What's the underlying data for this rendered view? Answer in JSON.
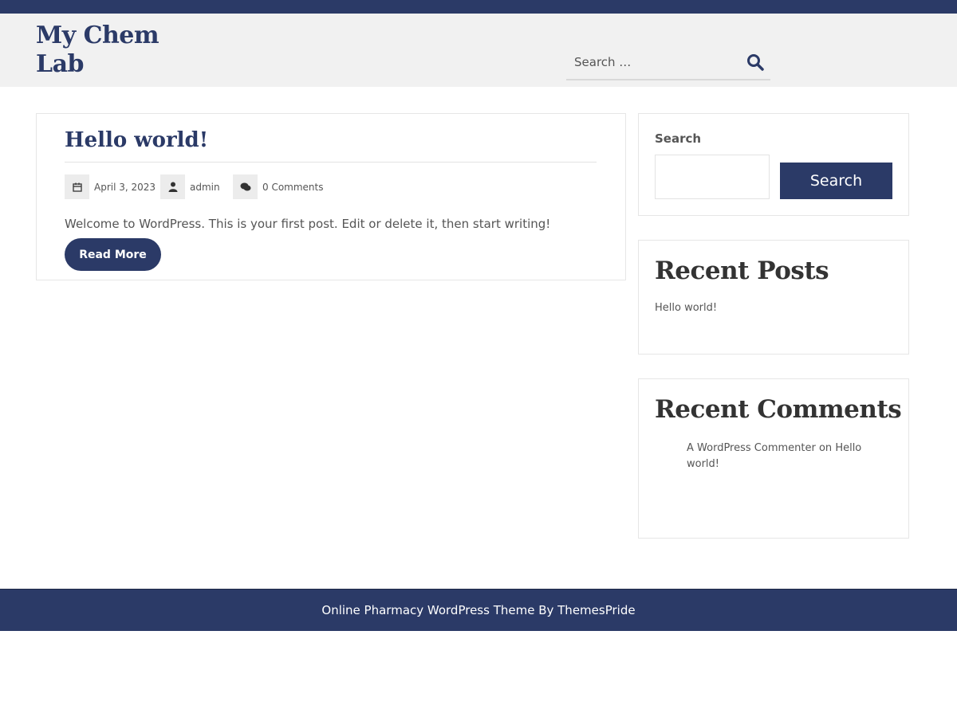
{
  "header": {
    "site_title": "My Chem Lab",
    "search_placeholder": "Search …"
  },
  "post": {
    "title": "Hello world!",
    "date": "April 3, 2023",
    "author": "admin",
    "comments": "0 Comments",
    "excerpt": "Welcome to WordPress. This is your first post. Edit or delete it, then start writing!",
    "read_more": "Read More"
  },
  "sidebar": {
    "search": {
      "label": "Search",
      "button": "Search"
    },
    "recent_posts": {
      "heading": "Recent Posts",
      "items": [
        "Hello world!"
      ]
    },
    "recent_comments": {
      "heading": "Recent Comments",
      "items": [
        {
          "author": "A WordPress Commenter",
          "connector": "on",
          "post": "Hello world!"
        }
      ]
    }
  },
  "footer": {
    "text": "Online Pharmacy WordPress Theme By ThemesPride"
  },
  "colors": {
    "primary": "#2b3a67",
    "header_bg": "#f1f1f1"
  }
}
